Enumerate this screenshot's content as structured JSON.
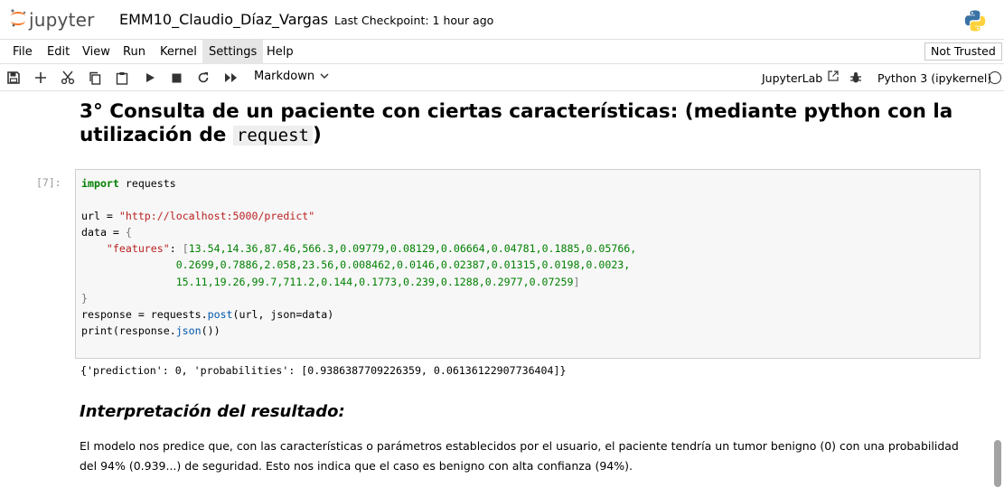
{
  "header": {
    "logo_text": "jupyter",
    "notebook_title": "EMM10_Claudio_Díaz_Vargas",
    "checkpoint": "Last Checkpoint: 1 hour ago"
  },
  "menu": {
    "items": [
      "File",
      "Edit",
      "View",
      "Run",
      "Kernel",
      "Settings",
      "Help"
    ],
    "active": "Settings",
    "trust_label": "Not Trusted"
  },
  "toolbar": {
    "cell_type": "Markdown",
    "jupyterlab_label": "JupyterLab",
    "kernel_name": "Python 3 (ipykernel)"
  },
  "cells": {
    "heading_line1": "3° Consulta de un paciente con ciertas características: (mediante python con la",
    "heading_line2_prefix": "utilización de",
    "heading_code": "request",
    "heading_line2_suffix": ")",
    "prompt": "[7]:",
    "code": {
      "import_kw": "import",
      "import_mod": " requests",
      "url_var": "url = ",
      "url_val": "\"http://localhost:5000/predict\"",
      "data_var": "data = ",
      "open_brace": "{",
      "features_key": "\"features\"",
      "features_colon": ": ",
      "open_bracket": "[",
      "features_line1": "13.54,14.36,87.46,566.3,0.09779,0.08129,0.06664,0.04781,0.1885,0.05766,",
      "features_line2": "0.2699,0.7886,2.058,23.56,0.008462,0.0146,0.02387,0.01315,0.0198,0.0023,",
      "features_line3": "15.11,19.26,99.7,711.2,0.144,0.1773,0.239,0.1288,0.2977,0.07259",
      "close_bracket": "]",
      "close_brace": "}",
      "response_pre": "response = requests.",
      "post_fn": "post",
      "response_post": "(url, json=data)",
      "print_pre": "print(response.",
      "json_fn": "json",
      "print_post": "())"
    },
    "output": "{'prediction': 0, 'probabilities': [0.9386387709226359, 0.06136122907736404]}",
    "subheading": "Interpretación del resultado:",
    "paragraph": "El modelo nos predice que, con las características o parámetros establecidos por el usuario, el paciente tendría un tumor benigno (0) con una probabilidad del 94% (0.939...) de seguridad. Esto nos indica que el caso es benigno con alta confianza (94%)."
  },
  "icons": [
    "jupyter-logo-icon",
    "python-logo-icon",
    "save-icon",
    "add-cell-icon",
    "cut-icon",
    "copy-icon",
    "paste-icon",
    "run-icon",
    "stop-icon",
    "restart-icon",
    "run-all-icon",
    "chevron-down-icon",
    "external-link-icon",
    "bug-icon",
    "kernel-status-icon"
  ]
}
